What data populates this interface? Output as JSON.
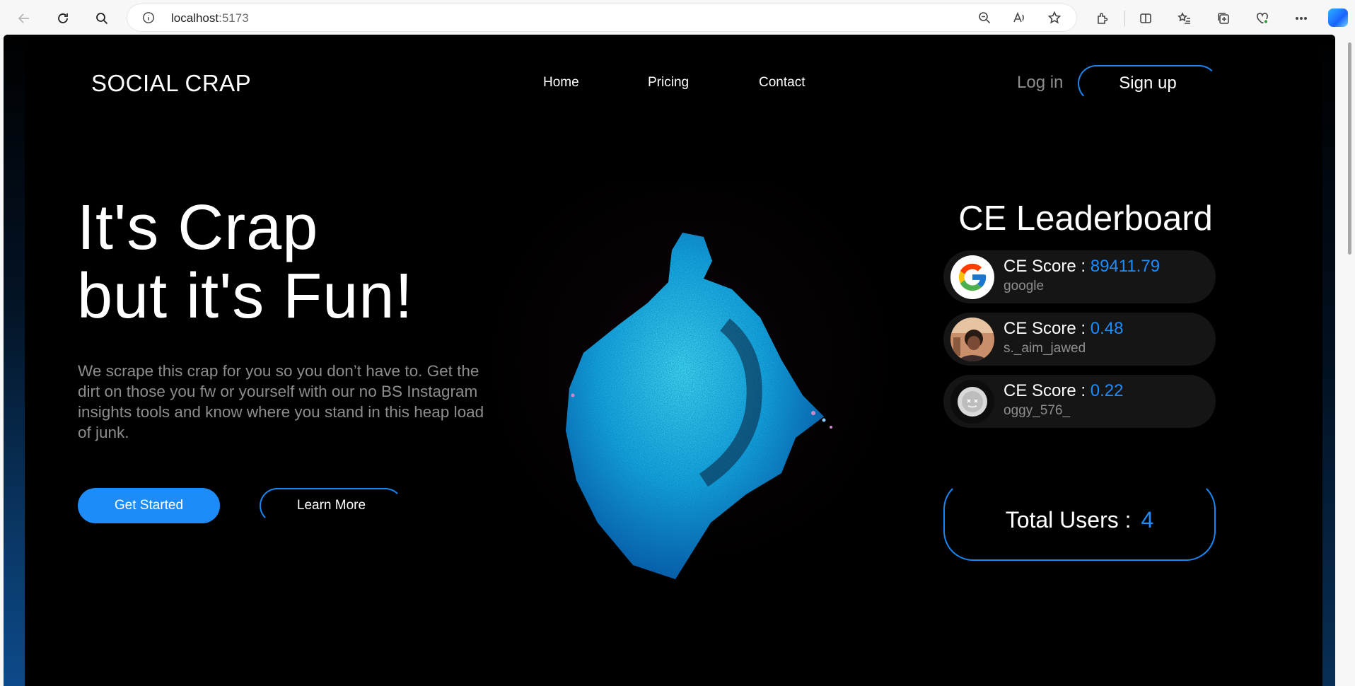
{
  "browser": {
    "url_host": "localhost",
    "url_port": ":5173"
  },
  "header": {
    "logo": "SOCIAL CRAP",
    "nav": [
      "Home",
      "Pricing",
      "Contact"
    ],
    "login": "Log in",
    "signup": "Sign up"
  },
  "hero": {
    "title_line1": "It's Crap",
    "title_line2": "but it's Fun!",
    "description": "We scrape this crap for you so you don’t have to. Get the dirt on those you fw or yourself with our no BS Instagram insights tools and know where you stand in this heap load of junk.",
    "primary_button": "Get Started",
    "secondary_button": "Learn More"
  },
  "leaderboard": {
    "title": "CE Leaderboard",
    "score_label": "CE Score :",
    "entries": [
      {
        "score": "89411.79",
        "username": "google"
      },
      {
        "score": "0.48",
        "username": "s._aim_jawed"
      },
      {
        "score": "0.22",
        "username": "oggy_576_"
      }
    ],
    "total_label": "Total Users :",
    "total_value": "4"
  },
  "colors": {
    "accent": "#1d8cf8",
    "background": "#000000"
  }
}
